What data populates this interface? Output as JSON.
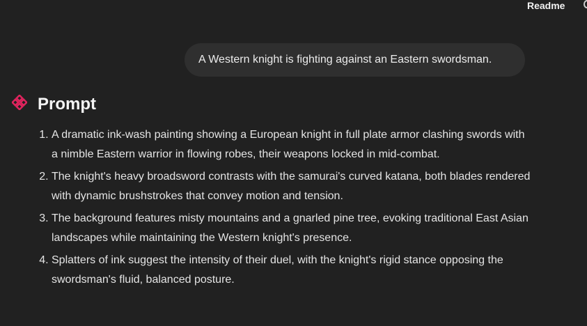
{
  "header": {
    "readme_label": "Readme"
  },
  "user_message": {
    "text": "A Western knight is fighting against an Eastern swordsman."
  },
  "assistant": {
    "icon": "sparkle-icon",
    "accent_color": "#e0245e",
    "section_title": "Prompt",
    "items": [
      "A dramatic ink-wash painting showing a European knight in full plate armor clashing swords with a nimble Eastern warrior in flowing robes, their weapons locked in mid-combat.",
      "The knight's heavy broadsword contrasts with the samurai's curved katana, both blades rendered with dynamic brushstrokes that convey motion and tension.",
      "The background features misty mountains and a gnarled pine tree, evoking traditional East Asian landscapes while maintaining the Western knight's presence.",
      "Splatters of ink suggest the intensity of their duel, with the knight's rigid stance opposing the swordsman's fluid, balanced posture."
    ]
  }
}
